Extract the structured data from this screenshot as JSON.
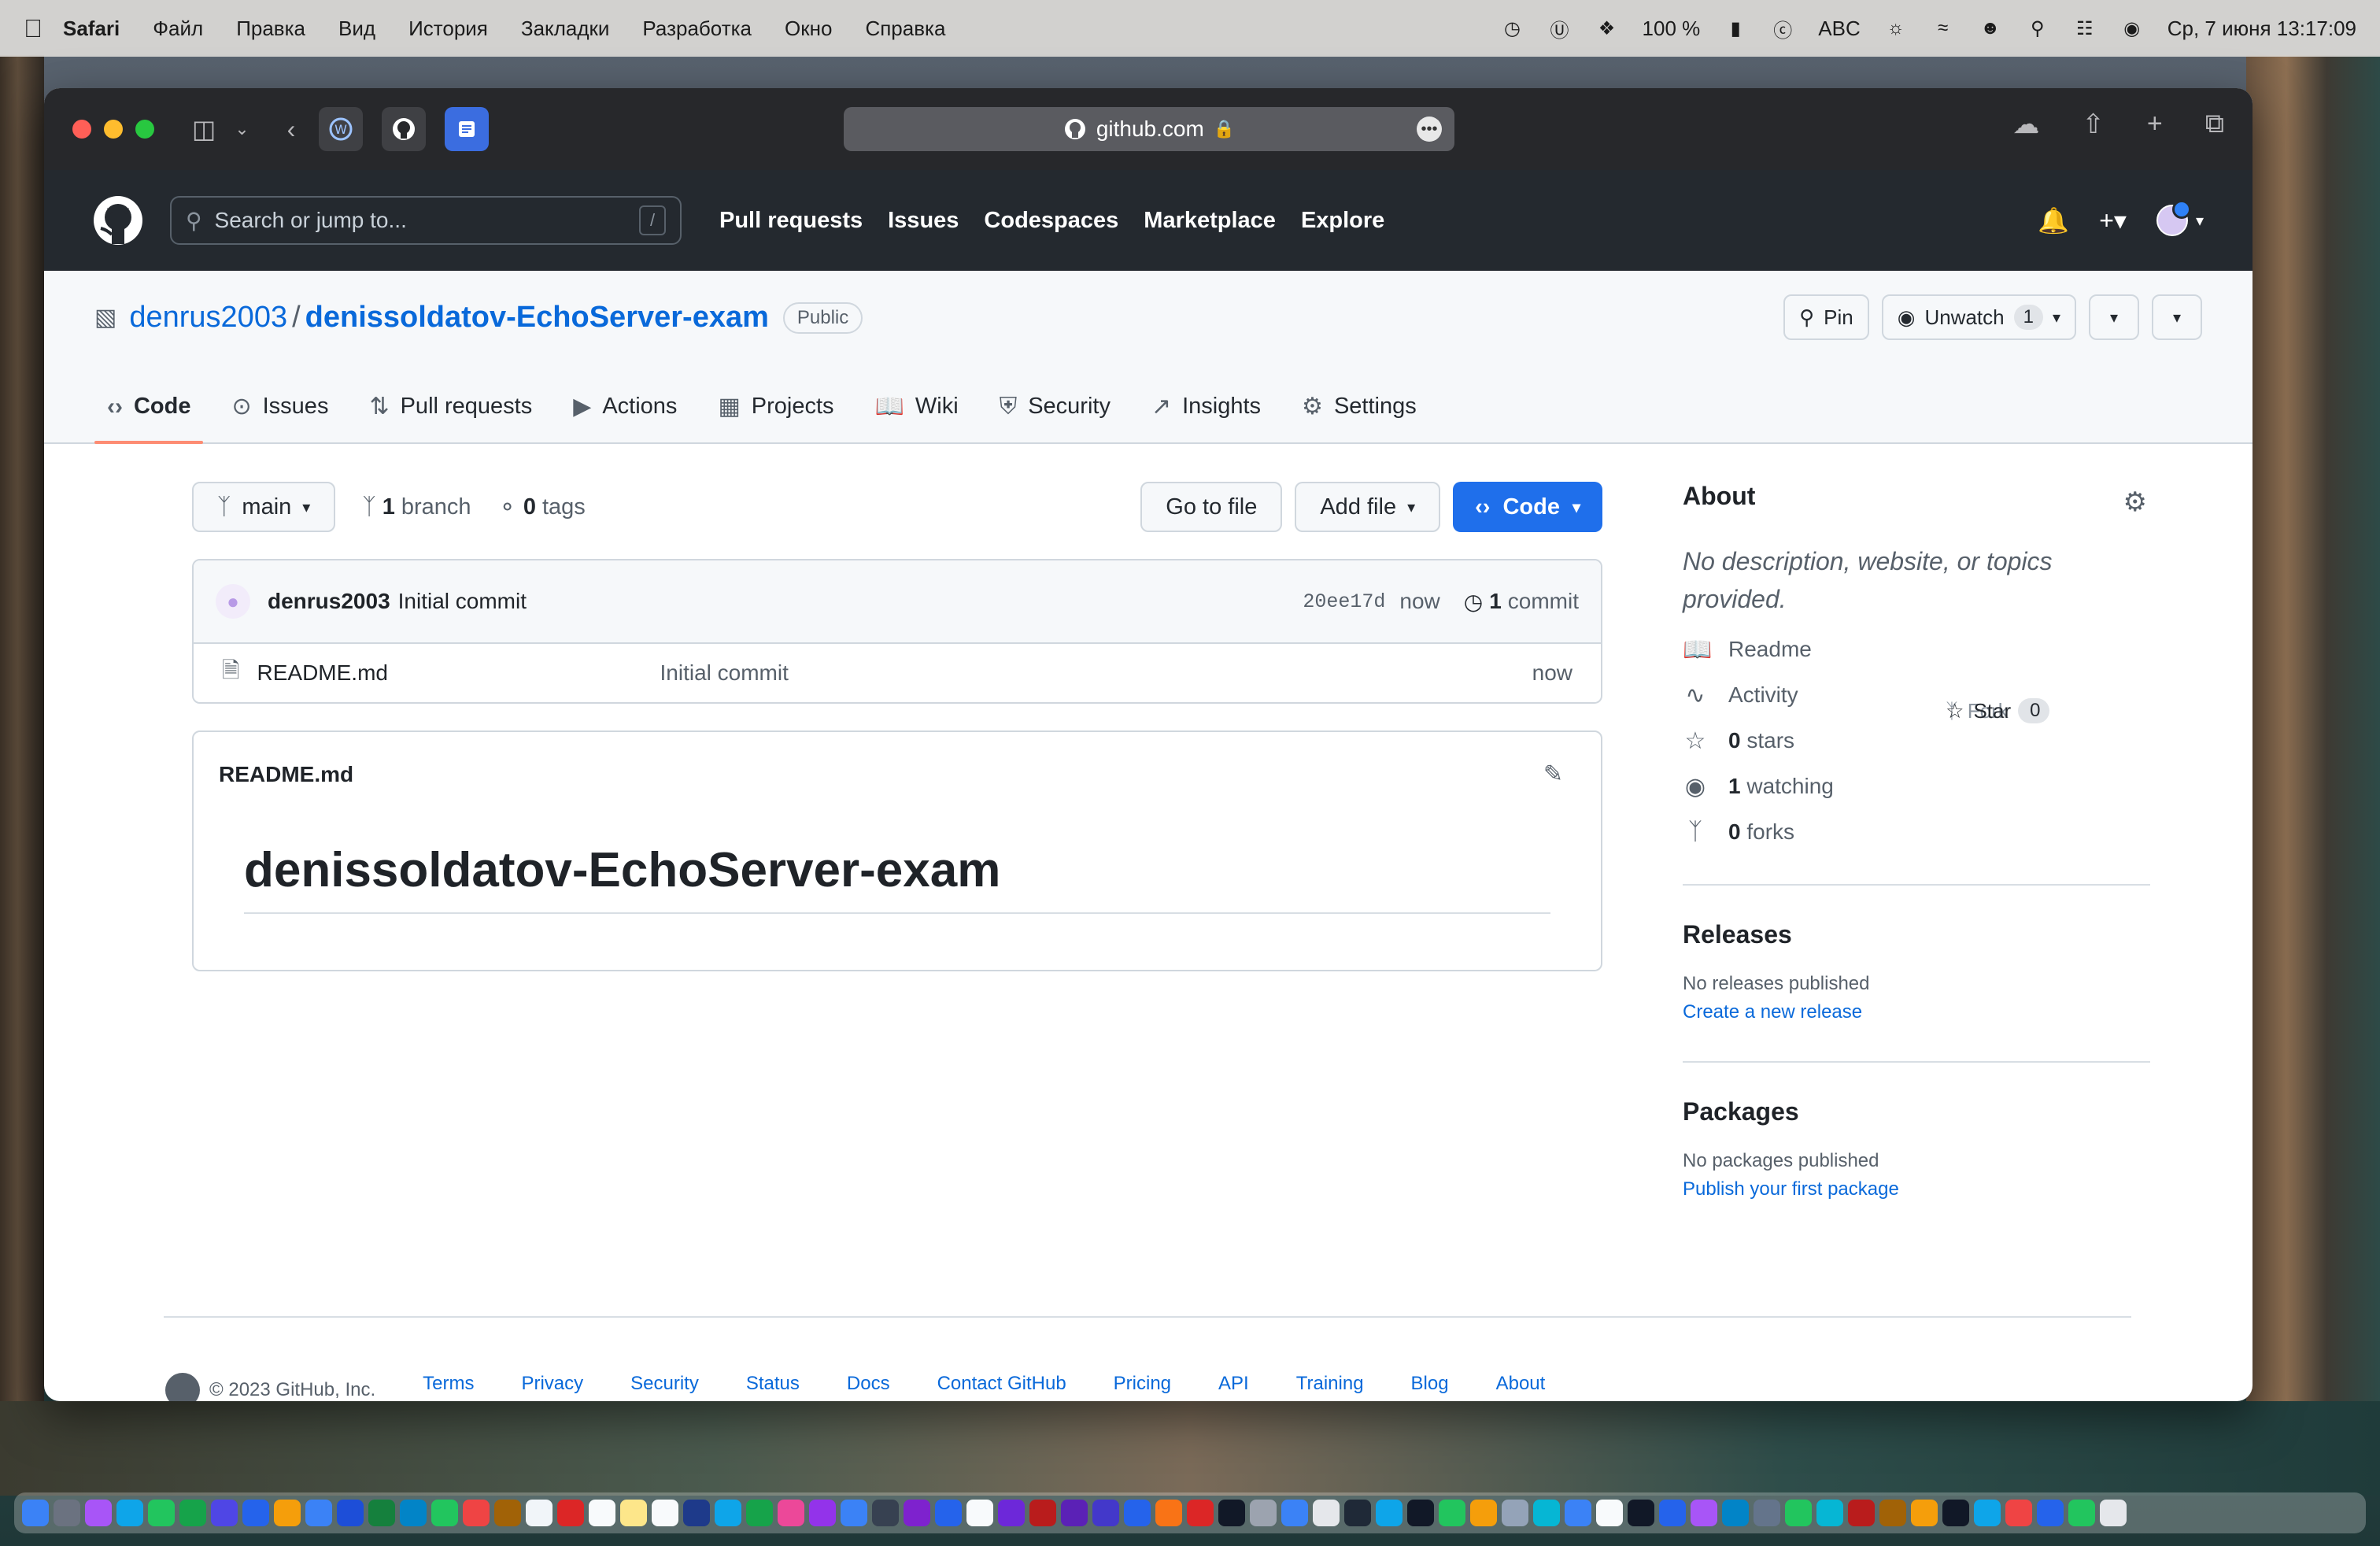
{
  "menubar": {
    "app": "Safari",
    "items": [
      "Файл",
      "Правка",
      "Вид",
      "История",
      "Закладки",
      "Разработка",
      "Окно",
      "Справка"
    ],
    "battery": "100 %",
    "input_source": "ABC",
    "datetime": "Ср, 7 июня  13:17:09"
  },
  "browser": {
    "url": "github.com"
  },
  "gh_header": {
    "search_placeholder": "Search or jump to...",
    "search_shortcut": "/",
    "nav": [
      "Pull requests",
      "Issues",
      "Codespaces",
      "Marketplace",
      "Explore"
    ]
  },
  "repo": {
    "owner": "denrus2003",
    "separator": "/",
    "name": "denissoldatov-EchoServer-exam",
    "visibility": "Public",
    "pin_label": "Pin",
    "unwatch_label": "Unwatch",
    "watch_count": "1",
    "fork_label": "Fork",
    "fork_count": "0",
    "star_label": "Star",
    "star_count": "0",
    "tabs": [
      {
        "label": "Code",
        "icon": "code-icon",
        "active": true
      },
      {
        "label": "Issues",
        "icon": "issue-icon"
      },
      {
        "label": "Pull requests",
        "icon": "pull-request-icon"
      },
      {
        "label": "Actions",
        "icon": "play-icon"
      },
      {
        "label": "Projects",
        "icon": "table-icon"
      },
      {
        "label": "Wiki",
        "icon": "book-icon"
      },
      {
        "label": "Security",
        "icon": "shield-icon"
      },
      {
        "label": "Insights",
        "icon": "graph-icon"
      },
      {
        "label": "Settings",
        "icon": "gear-icon"
      }
    ]
  },
  "toolbar": {
    "branch": "main",
    "branch_count": "1",
    "branch_word": "branch",
    "tag_count": "0",
    "tag_word": "tags",
    "go_to_file": "Go to file",
    "add_file": "Add file",
    "code_button": "Code"
  },
  "commit": {
    "author": "denrus2003",
    "message": "Initial commit",
    "sha": "20ee17d",
    "age": "now",
    "count": "1",
    "count_word": "commit"
  },
  "files": [
    {
      "name": "README.md",
      "message": "Initial commit",
      "age": "now"
    }
  ],
  "readme": {
    "title": "README.md",
    "heading": "denissoldatov-EchoServer-exam"
  },
  "about": {
    "title": "About",
    "description": "No description, website, or topics provided.",
    "readme": "Readme",
    "activity": "Activity",
    "stars_count": "0",
    "stars_word": "stars",
    "watching_count": "1",
    "watching_word": "watching",
    "forks_count": "0",
    "forks_word": "forks"
  },
  "releases": {
    "title": "Releases",
    "empty": "No releases published",
    "link": "Create a new release"
  },
  "packages": {
    "title": "Packages",
    "empty": "No packages published",
    "link": "Publish your first package"
  },
  "footer": {
    "copyright": "© 2023 GitHub, Inc.",
    "links": [
      "Terms",
      "Privacy",
      "Security",
      "Status",
      "Docs",
      "Contact GitHub",
      "Pricing",
      "API",
      "Training",
      "Blog",
      "About"
    ]
  },
  "colors": {
    "link": "#0969da",
    "header_bg": "#24292f",
    "code_button": "#1f6feb",
    "active_tab_underline": "#fd8c73"
  }
}
